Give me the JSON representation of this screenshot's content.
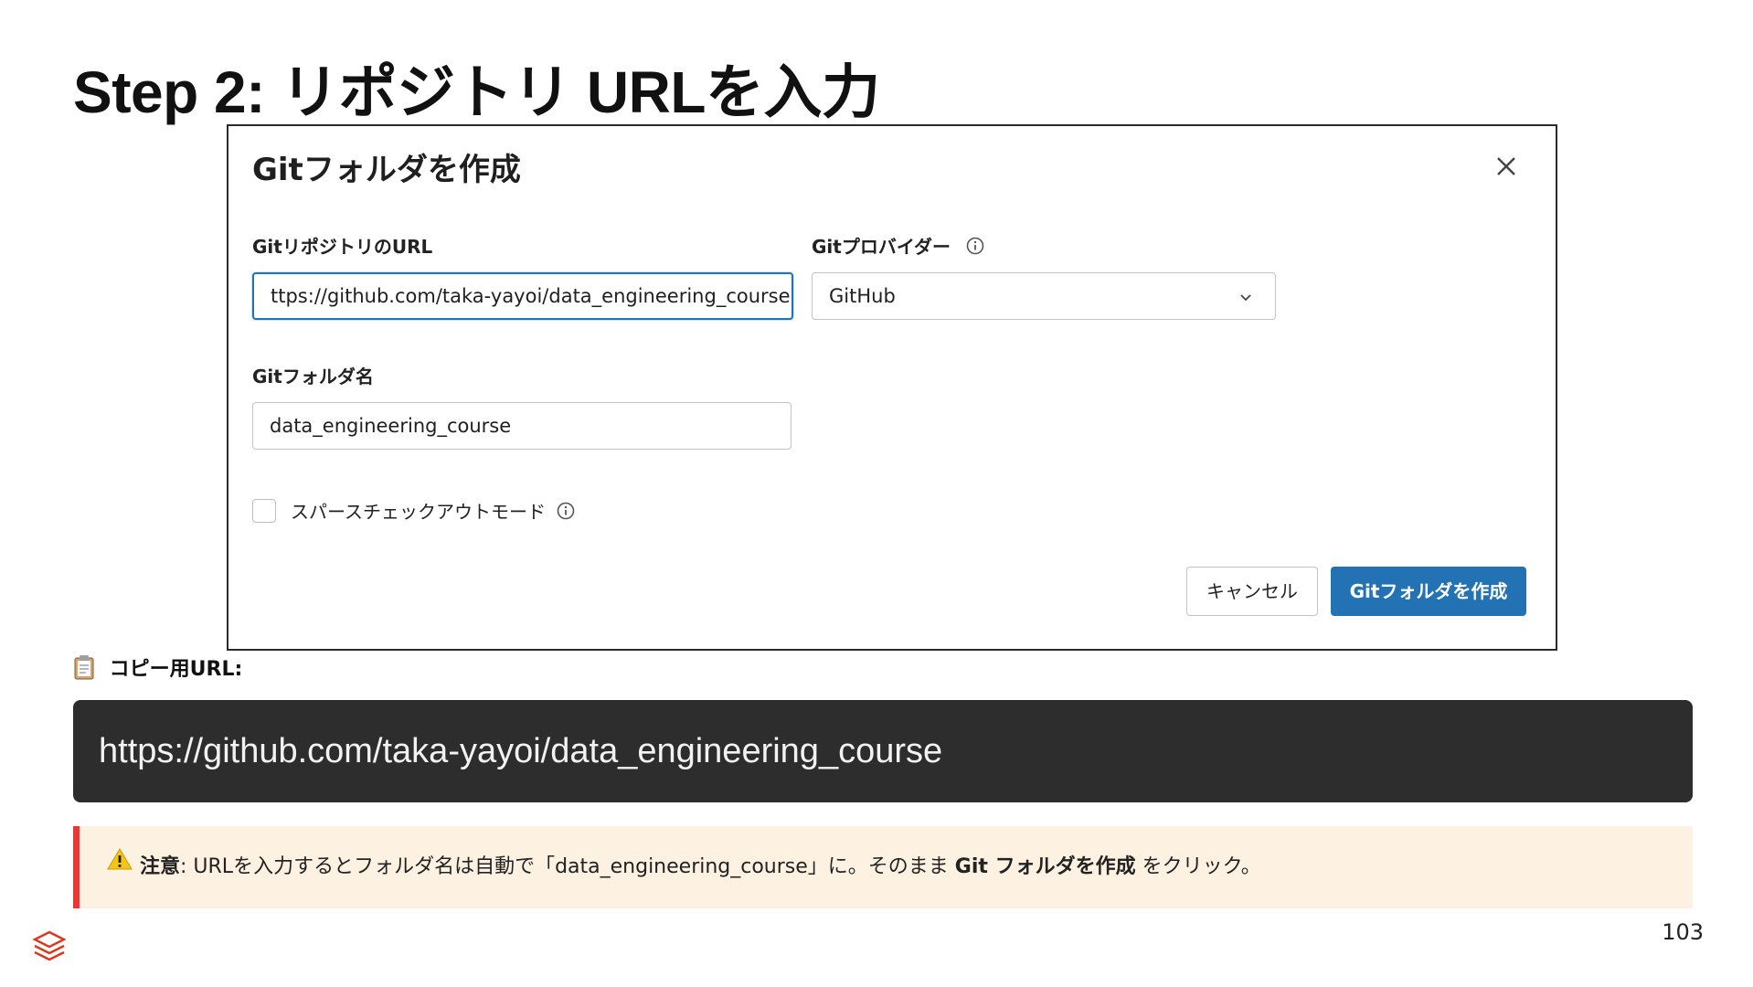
{
  "slide": {
    "title": "Step 2: リポジトリ URLを入力",
    "page_number": "103"
  },
  "dialog": {
    "title": "Gitフォルダを作成",
    "url_label": "GitリポジトリのURL",
    "url_value": "ttps://github.com/taka-yayoi/data_engineering_course",
    "provider_label": "Gitプロバイダー",
    "provider_value": "GitHub",
    "folder_label": "Gitフォルダ名",
    "folder_value": "data_engineering_course",
    "sparse_checkout_label": "スパースチェックアウトモード",
    "cancel_label": "キャンセル",
    "create_label": "Gitフォルダを作成"
  },
  "copy": {
    "label": "コピー用URL:",
    "url": "https://github.com/taka-yayoi/data_engineering_course"
  },
  "note": {
    "strong": "注意",
    "text": ": URLを入力するとフォルダ名は自動で「data_engineering_course」に。そのまま ",
    "emphasis": "Git フォルダを作成",
    "suffix": " をクリック。"
  },
  "colors": {
    "primary": "#2272b4",
    "code_bg": "#2d2d2d",
    "note_bg": "#fdf1e2",
    "note_border": "#e53935"
  }
}
